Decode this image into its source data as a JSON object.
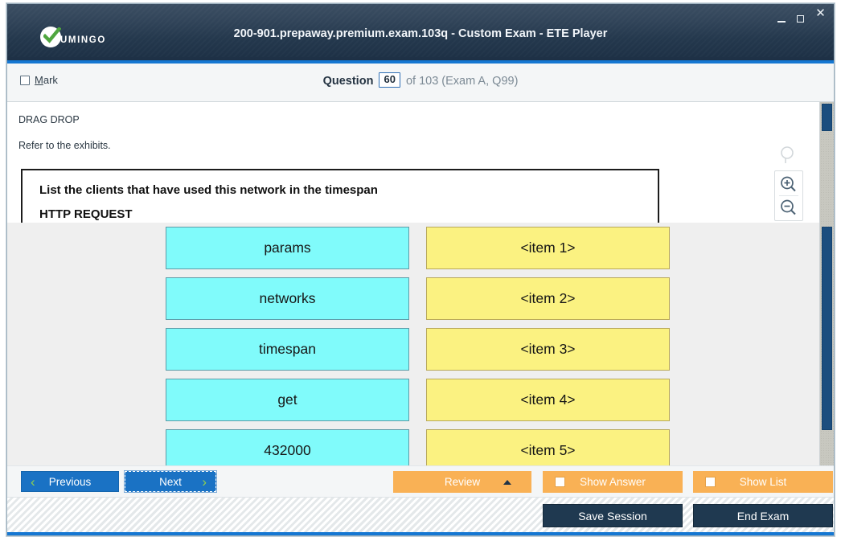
{
  "window": {
    "title": "200-901.prepaway.premium.exam.103q - Custom Exam - ETE Player",
    "brand_name": "UMINGO",
    "controls": {
      "minimize": "minimize-icon",
      "maximize": "maximize-icon",
      "close": "✕"
    },
    "accent_color": "#1577d2",
    "titlebar_color": "#24384d"
  },
  "question_header": {
    "mark_label_prefix": "",
    "mark_label": "Mark",
    "mark_accel": "M",
    "mark_rest": "ark",
    "mark_checked": false,
    "question_word": "Question",
    "question_number": "60",
    "of_text": "of 103 (Exam A, Q99)"
  },
  "question": {
    "type_label": "DRAG DROP",
    "instruction": "Refer to the exhibits.",
    "exhibit": {
      "line_1": "List the clients that have used this network in the timespan",
      "line_2": "HTTP REQUEST"
    }
  },
  "zoom_tools": {
    "plain": "magnifier-icon",
    "zoom_in": "zoom-in-icon",
    "zoom_out": "zoom-out-icon"
  },
  "dragdrop": {
    "source_color": "#80fbfb",
    "target_color": "#fbf281",
    "sources": [
      "params",
      "networks",
      "timespan",
      "get",
      "432000"
    ],
    "targets": [
      "<item 1>",
      "<item 2>",
      "<item 3>",
      "<item 4>",
      "<item 5>"
    ]
  },
  "navbar": {
    "previous_label": "Previous",
    "previous_chevron": "‹",
    "next_label": "Next",
    "next_chevron": "›",
    "review_label": "Review",
    "show_answer_label": "Show Answer",
    "show_answer_checked": false,
    "show_list_label": "Show List",
    "show_list_checked": false,
    "orange_color": "#f9b155",
    "blue_color": "#1a72c4"
  },
  "footer": {
    "save_session_label": "Save Session",
    "end_exam_label": "End Exam",
    "button_color": "#1f3950"
  }
}
